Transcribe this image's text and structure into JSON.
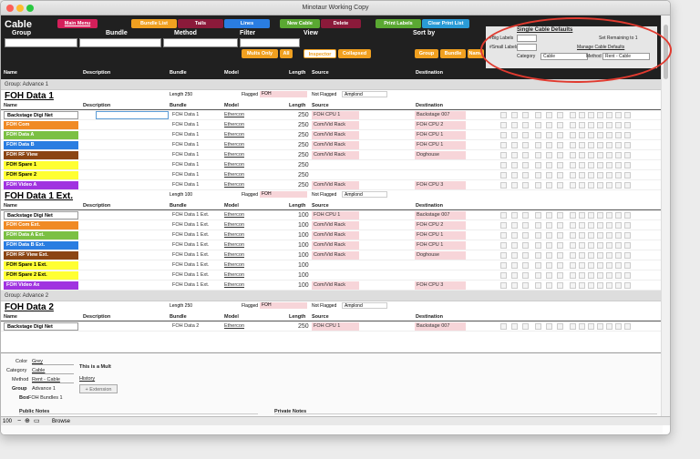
{
  "window": {
    "title": "Minotaur Working Copy"
  },
  "header": {
    "title": "Cable",
    "main_menu": "Main Menu",
    "bundle_list": "Bundle List",
    "tails": "Tails",
    "lines": "Lines",
    "new_cable": "New Cable",
    "delete": "Delete",
    "print_labels": "Print Labels",
    "clear_print_list": "Clear Print List",
    "labels": {
      "group": "Group",
      "bundle": "Bundle",
      "method": "Method",
      "filter": "Filter",
      "view": "View",
      "sort_by": "Sort by"
    },
    "mults_only": "Mults Only",
    "all": "All",
    "inspector": "Inspector",
    "collapsed": "Collapsed",
    "sort_group": "Group",
    "sort_bundle": "Bundle",
    "sort_name": "Name",
    "cols": {
      "name": "Name",
      "description": "Description",
      "bundle": "Bundle",
      "model": "Model",
      "length": "Length",
      "source": "Source",
      "destination": "Destination"
    }
  },
  "defaults": {
    "title": "Single Cable Defaults",
    "big_labels": "#Big Labels",
    "small_labels": "#Small Labels",
    "set_remaining": "Set Remaining to 1",
    "manage": "Manage Cable Defaults",
    "category_label": "Category",
    "category": "Cable",
    "method_label": "Method",
    "method": "Rent - Cable"
  },
  "groups": [
    "Group: Advance 1",
    "Group: Advance 2"
  ],
  "bundles": [
    {
      "title": "FOH Data 1",
      "length": "Length 250",
      "flagged": "Flagged",
      "flagged_val": "FOH",
      "not_flagged": "Not Flagged",
      "not_flagged_val": "Amplond",
      "rows": [
        {
          "name": "Backstage Digi Net",
          "color": "#ffffff",
          "text": "#000",
          "bundle": "FOH Data 1",
          "model": "Ethercon",
          "len": "250",
          "src": "FOH CPU 1",
          "dst": "Backstage 007"
        },
        {
          "name": "FOH Com",
          "color": "#f08a24",
          "text": "#fff",
          "bundle": "FOH Data 1",
          "model": "Ethercon",
          "len": "250",
          "src": "Com/Vid Rack",
          "dst": "FOH CPU 2"
        },
        {
          "name": "FOH Data A",
          "color": "#7bc043",
          "text": "#fff",
          "bundle": "FOH Data 1",
          "model": "Ethercon",
          "len": "250",
          "src": "Com/Vid Rack",
          "dst": "FOH CPU 1"
        },
        {
          "name": "FOH Data B",
          "color": "#2a7de1",
          "text": "#fff",
          "bundle": "FOH Data 1",
          "model": "Ethercon",
          "len": "250",
          "src": "Com/Vid Rack",
          "dst": "FOH CPU 1"
        },
        {
          "name": "FOH RF View",
          "color": "#8b4513",
          "text": "#fff",
          "bundle": "FOH Data 1",
          "model": "Ethercon",
          "len": "250",
          "src": "Com/Vid Rack",
          "dst": "Doghouse"
        },
        {
          "name": "FOH Spare 1",
          "color": "#ffff33",
          "text": "#000",
          "bundle": "FOH Data 1",
          "model": "Ethercon",
          "len": "250",
          "src": "",
          "dst": ""
        },
        {
          "name": "FOH Spare 2",
          "color": "#ffff33",
          "text": "#000",
          "bundle": "FOH Data 1",
          "model": "Ethercon",
          "len": "250",
          "src": "",
          "dst": ""
        },
        {
          "name": "FOH Video A",
          "color": "#a033e0",
          "text": "#fff",
          "bundle": "FOH Data 1",
          "model": "Ethercon",
          "len": "250",
          "src": "Com/Vid Rack",
          "dst": "FOH CPU 3"
        }
      ]
    },
    {
      "title": "FOH Data 1 Ext.",
      "length": "Length 100",
      "flagged": "Flagged",
      "flagged_val": "FOH",
      "not_flagged": "Not Flagged",
      "not_flagged_val": "Amplond",
      "rows": [
        {
          "name": "Backstage Digi Net",
          "color": "#ffffff",
          "text": "#000",
          "bundle": "FOH Data 1 Ext.",
          "model": "Ethercon",
          "len": "100",
          "src": "FOH CPU 1",
          "dst": "Backstage 007"
        },
        {
          "name": "FOH Com Ext.",
          "color": "#f08a24",
          "text": "#fff",
          "bundle": "FOH Data 1 Ext.",
          "model": "Ethercon",
          "len": "100",
          "src": "Com/Vid Rack",
          "dst": "FOH CPU 2"
        },
        {
          "name": "FOH Data A Ext.",
          "color": "#7bc043",
          "text": "#fff",
          "bundle": "FOH Data 1 Ext.",
          "model": "Ethercon",
          "len": "100",
          "src": "Com/Vid Rack",
          "dst": "FOH CPU 1"
        },
        {
          "name": "FOH Data B Ext.",
          "color": "#2a7de1",
          "text": "#fff",
          "bundle": "FOH Data 1 Ext.",
          "model": "Ethercon",
          "len": "100",
          "src": "Com/Vid Rack",
          "dst": "FOH CPU 1"
        },
        {
          "name": "FOH RF View Ext.",
          "color": "#8b4513",
          "text": "#fff",
          "bundle": "FOH Data 1 Ext.",
          "model": "Ethercon",
          "len": "100",
          "src": "Com/Vid Rack",
          "dst": "Doghouse"
        },
        {
          "name": "FOH Spare 1 Ext.",
          "color": "#ffff33",
          "text": "#000",
          "bundle": "FOH Data 1 Ext.",
          "model": "Ethercon",
          "len": "100",
          "src": "",
          "dst": ""
        },
        {
          "name": "FOH Spare 2 Ext.",
          "color": "#ffff33",
          "text": "#000",
          "bundle": "FOH Data 1 Ext.",
          "model": "Ethercon",
          "len": "100",
          "src": "",
          "dst": ""
        },
        {
          "name": "FOH Video Ax",
          "color": "#a033e0",
          "text": "#fff",
          "bundle": "FOH Data 1 Ext.",
          "model": "Ethercon",
          "len": "100",
          "src": "Com/Vid Rack",
          "dst": "FOH CPU 3"
        }
      ]
    },
    {
      "title": "FOH Data 2",
      "length": "Length 250",
      "flagged": "Flagged",
      "flagged_val": "FOH",
      "not_flagged": "Not Flagged",
      "not_flagged_val": "Amplond",
      "rows": [
        {
          "name": "Backstage Digi Net",
          "color": "#ffffff",
          "text": "#000",
          "bundle": "FOH Data 2",
          "model": "Ethercon",
          "len": "250",
          "src": "FOH CPU 1",
          "dst": "Backstage 007"
        }
      ]
    }
  ],
  "detail": {
    "color_label": "Color",
    "color": "Grey",
    "category_label": "Category",
    "category": "Cable",
    "method_label": "Method",
    "method": "Rent - Cable",
    "group_label": "Group",
    "group": "Advance 1",
    "box_label": "Box",
    "box": "FOH Bundles 1",
    "mult_note": "This is a Mult",
    "history": "History",
    "extension": "+ Extension",
    "public_notes": "Public Notes",
    "private_notes": "Private Notes"
  },
  "status": {
    "zoom": "100",
    "mode": "Browse"
  }
}
